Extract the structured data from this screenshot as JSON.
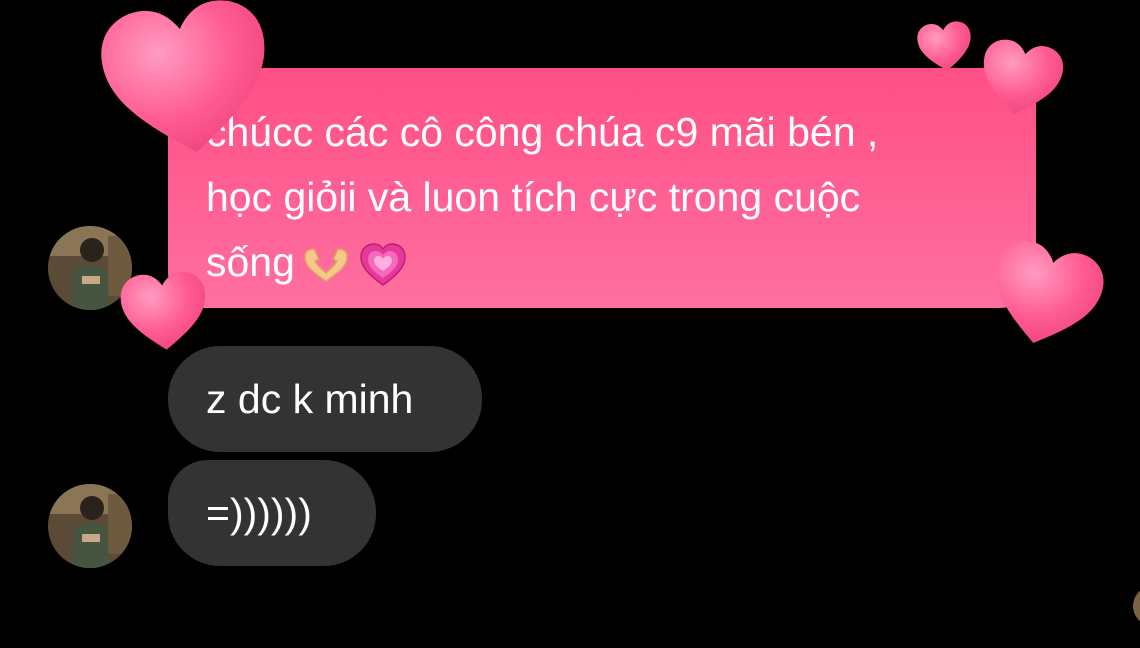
{
  "conversation": {
    "messages": [
      {
        "sender": "them",
        "style": "pink",
        "lines": [
          "chúcc các cô công chúa c9 mãi bén ,",
          "học giỏii và luon tích cực trong cuộc",
          "sống"
        ],
        "trailing_emojis": [
          "heart-hands-emoji",
          "growing-heart-emoji"
        ]
      },
      {
        "sender": "them",
        "style": "dark",
        "text": "z dc k minh"
      },
      {
        "sender": "them",
        "style": "dark",
        "text": "=))))))"
      }
    ],
    "reaction_effect": "floating-hearts",
    "colors": {
      "background": "#000000",
      "pink_bubble_top": "#ff4f86",
      "pink_bubble_bottom": "#ff6fa0",
      "dark_bubble": "#333333",
      "text": "#ffffff",
      "heart": "#ff5c93"
    }
  }
}
